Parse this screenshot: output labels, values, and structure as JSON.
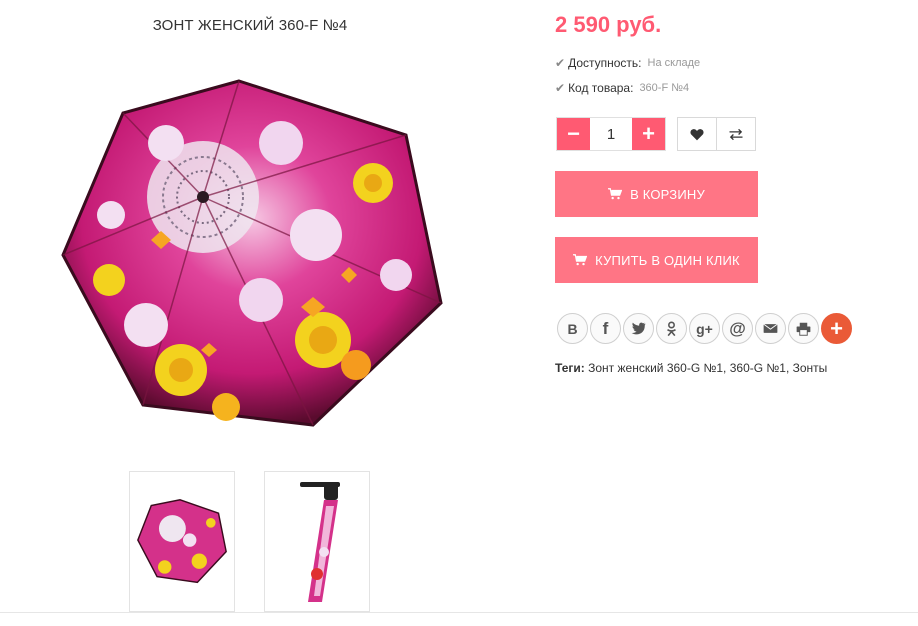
{
  "product": {
    "title": "ЗОНТ ЖЕНСКИЙ 360-F №4",
    "price": "2 590 руб.",
    "availability_label": "Доступность:",
    "availability_value": "На складе",
    "sku_label": "Код товара:",
    "sku_value": "360-F №4"
  },
  "gallery": {
    "main_image": "pink-floral-umbrella-open",
    "thumbnails": [
      "pink-umbrella-open-thumb",
      "pink-umbrella-folded-thumb"
    ]
  },
  "quantity": {
    "minus": "−",
    "value": "1",
    "plus": "+"
  },
  "icons": {
    "wishlist": "heart-icon",
    "compare": "compare-arrows-icon",
    "cart": "cart-icon"
  },
  "actions": {
    "add_to_cart": "В КОРЗИНУ",
    "buy_one_click": "КУПИТЬ В ОДИН КЛИК"
  },
  "share": {
    "vk": "В",
    "facebook": "f",
    "twitter": "t",
    "odnoklassniki": "ok",
    "googleplus": "g+",
    "email_at": "@",
    "mail": "mail",
    "print": "print",
    "more": "+"
  },
  "tags": {
    "label": "Теги:",
    "value": "Зонт женский 360-G №1, 360-G №1, Зонты"
  },
  "colors": {
    "accent": "#ff5a72",
    "button": "#ff7585",
    "share_more": "#ea5a37"
  }
}
